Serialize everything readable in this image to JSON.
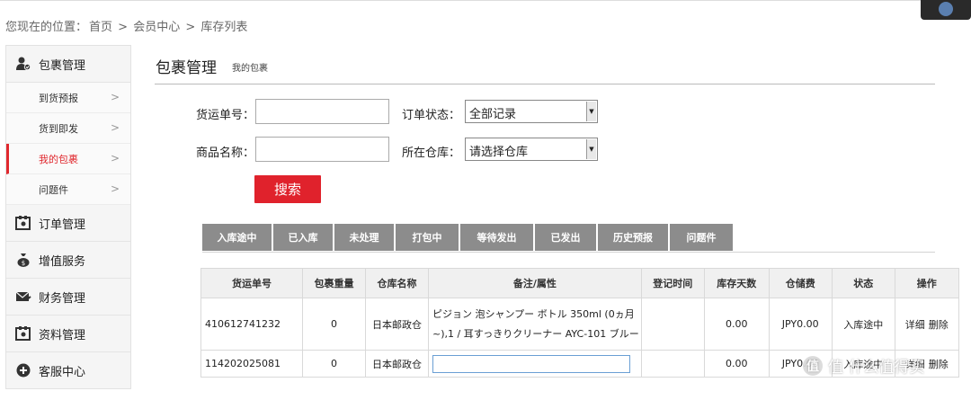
{
  "breadcrumb": {
    "prefix": "您现在的位置：",
    "items": [
      "首页",
      "会员中心",
      "库存列表"
    ],
    "separator": ">"
  },
  "sidebar": {
    "groups": [
      {
        "label": "包裹管理",
        "icon": "package-user-icon"
      },
      {
        "label": "订单管理",
        "icon": "order-icon"
      },
      {
        "label": "增值服务",
        "icon": "moneybag-icon"
      },
      {
        "label": "财务管理",
        "icon": "finance-mail-icon"
      },
      {
        "label": "资料管理",
        "icon": "profile-icon"
      },
      {
        "label": "客服中心",
        "icon": "plus-circle-icon"
      }
    ],
    "sub_items": [
      {
        "label": "到货预报",
        "active": false
      },
      {
        "label": "货到即发",
        "active": false
      },
      {
        "label": "我的包裹",
        "active": true
      },
      {
        "label": "问题件",
        "active": false
      }
    ],
    "accent": "#e0282e"
  },
  "main": {
    "title": "包裹管理",
    "subtitle": "我的包裹"
  },
  "form": {
    "tracking_label": "货运单号：",
    "tracking_value": "",
    "product_label": "商品名称：",
    "product_value": "",
    "status_label": "订单状态：",
    "status_value": "全部记录",
    "warehouse_label": "所在仓库：",
    "warehouse_value": "请选择仓库",
    "search_label": "搜索",
    "search_color": "#e0222c"
  },
  "tabs": [
    "入库途中",
    "已入库",
    "未处理",
    "打包中",
    "等待发出",
    "已发出",
    "历史预报",
    "问题件"
  ],
  "table": {
    "headers": [
      "货运单号",
      "包裹重量",
      "仓库名称",
      "备注/属性",
      "登记时间",
      "库存天数",
      "仓储费",
      "状态",
      "操作"
    ],
    "rows": [
      {
        "tracking": "410612741232",
        "weight": "0",
        "warehouse": "日本邮政仓",
        "note_line1": "ピジョン 泡シャンプー ボトル 350ml (0ヵ月",
        "note_line2": "~),1 / 耳すっきりクリーナー AYC-101 ブルー",
        "time": "",
        "days": "0.00",
        "fee": "JPY0.00",
        "status": "入库途中",
        "op_detail": "详细",
        "op_delete": "删除"
      },
      {
        "tracking": "114202025081",
        "weight": "0",
        "warehouse": "日本邮政仓",
        "note_input": "",
        "time": "",
        "days": "0.00",
        "fee": "JPY0.00",
        "status": "入库途中",
        "op_detail": "详细",
        "op_delete": "删除"
      }
    ]
  },
  "watermark": {
    "text": "值 什么值得买",
    "icon": "smzdm-logo-icon"
  }
}
